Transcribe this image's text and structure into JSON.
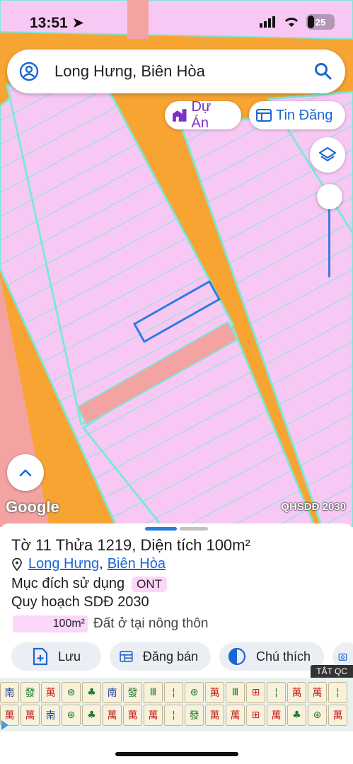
{
  "status_bar": {
    "time": "13:51",
    "battery": "25"
  },
  "search": {
    "text": "Long Hưng, Biên Hòa"
  },
  "chips": {
    "du_an": "Dự Án",
    "tin_dang": "Tin Đăng"
  },
  "map": {
    "logo": "Google",
    "layer_label": "QHSDĐ 2030",
    "opacity_level": 1.0
  },
  "colors": {
    "residential": "#f8c8f5",
    "road": "#f8a433",
    "park": "#f4a3a3",
    "parcel_line": "#7ee7d6",
    "selection": "#2a7de1",
    "accent": "#1a66d2"
  },
  "parcel": {
    "to_label": "Tờ",
    "to_value": "11",
    "thua_label": "Thửa",
    "thua_value": "1219",
    "area_label": ", Diện tích",
    "area_value": "100m²",
    "ward": "Long Hưng",
    "city": "Biên Hòa",
    "purpose_label": "Mục đích sử dụng",
    "purpose_code": "ONT",
    "plan_label": "Quy hoạch SDĐ 2030",
    "plan_area": "100m²",
    "plan_desc": "Đất ở tại nông thôn"
  },
  "actions": {
    "save": "Lưu",
    "sell": "Đăng bán",
    "legend": "Chú thích"
  },
  "ad": {
    "close_label": "TẮT QC"
  }
}
